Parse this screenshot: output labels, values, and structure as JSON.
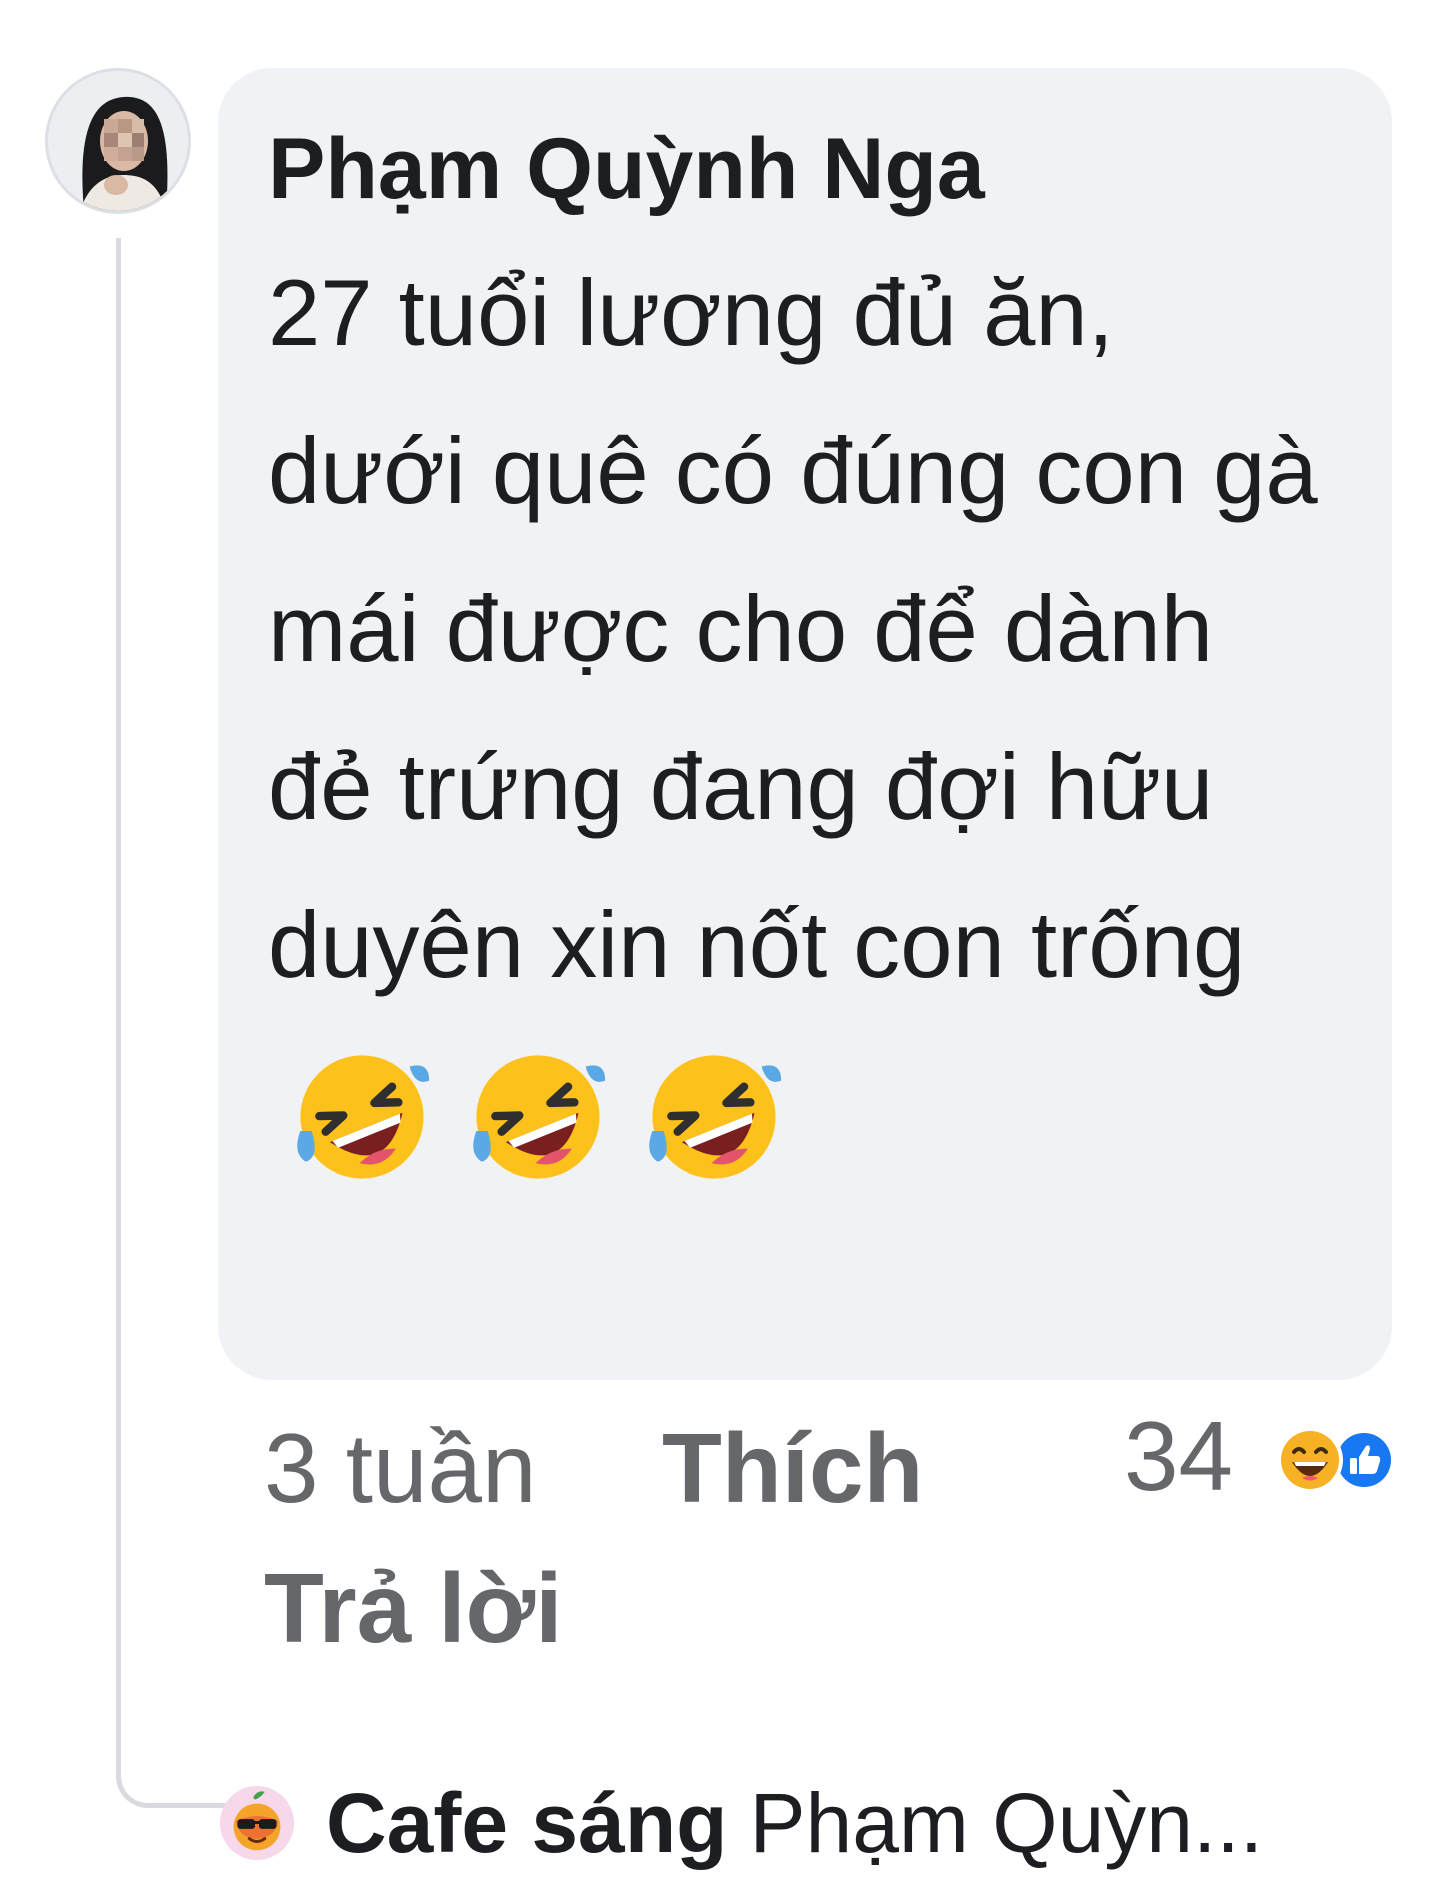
{
  "comment": {
    "author": "Phạm Quỳnh Nga",
    "text": "27 tuổi lương đủ ăn, dưới quê có đúng con gà mái được cho để dành đẻ trứng đang đợi hữu duyên xin nốt con trống",
    "emojis": [
      "rolling-on-floor-laughing",
      "rolling-on-floor-laughing",
      "rolling-on-floor-laughing"
    ],
    "time": "3 tuần",
    "like_label": "Thích",
    "reply_label": "Trả lời",
    "reaction_count": "34",
    "reaction_types": [
      "haha",
      "like"
    ]
  },
  "reply_preview": {
    "author": "Cafe sáng",
    "text": "Phạm Quỳn..."
  },
  "colors": {
    "bubble": "#f0f2f5",
    "secondary_text": "#65676b",
    "like_blue": "#1877f2",
    "emoji_yellow": "#fcc21b"
  }
}
